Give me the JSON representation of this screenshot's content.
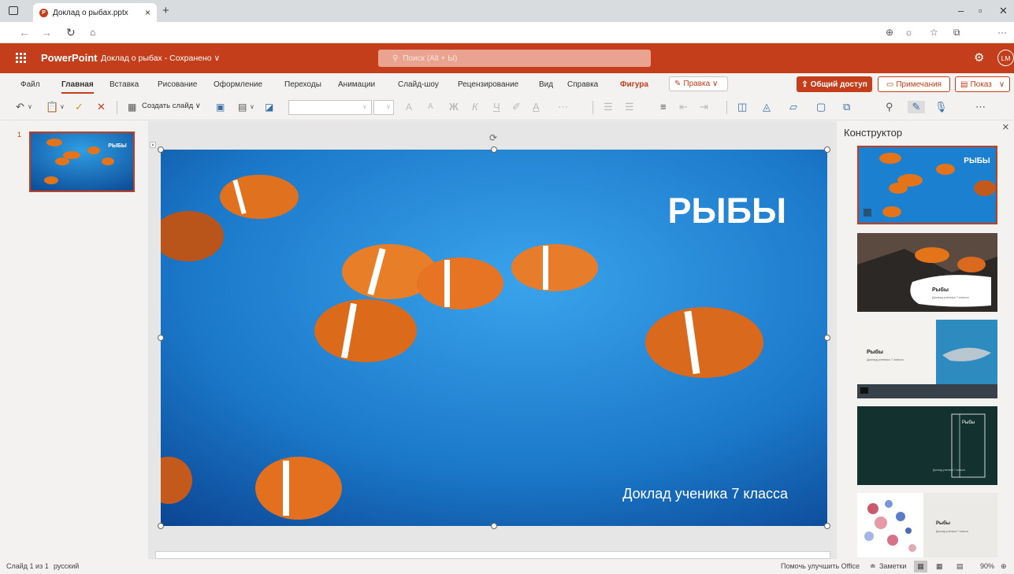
{
  "browser": {
    "tab_title": "Доклад о рыбах.pptx",
    "tab_close": "×",
    "new_tab": "+",
    "minimize": "–",
    "maximize": "▫",
    "close": "✕",
    "more": "···"
  },
  "header": {
    "app_name": "PowerPoint",
    "doc_title": "Доклад о рыбах - Сохранено ∨",
    "search_placeholder": "Поиск (Alt + Ы)",
    "avatar_initials": "LM"
  },
  "ribbon": {
    "tabs": [
      "Файл",
      "Главная",
      "Вставка",
      "Рисование",
      "Оформление",
      "Переходы",
      "Анимации",
      "Слайд-шоу",
      "Рецензирование",
      "Вид",
      "Справка",
      "Фигура"
    ],
    "edit_label": "Правка ∨",
    "share_label": "Общий доступ",
    "comments_label": "Примечания",
    "show_label": "Показ",
    "new_slide_label": "Создать слайд ∨",
    "bold": "Ж",
    "italic": "К",
    "underline": "Ч",
    "grow_font": "A",
    "shrink_font": "A"
  },
  "thumbnails": {
    "slide_number": "1",
    "thumb_title": "РЫБЫ"
  },
  "slide": {
    "title": "РЫБЫ",
    "subtitle": "Доклад ученика 7 класса"
  },
  "designer": {
    "title": "Конструктор",
    "close": "×",
    "designs": [
      {
        "title": "РЫБЫ"
      },
      {
        "title": "Рыбы",
        "subtitle": "Доклад ученика 7 класса"
      },
      {
        "title": "Рыбы",
        "subtitle": "Доклад ученика 7 класса"
      },
      {
        "title": "Рыбы",
        "subtitle": "Доклад ученика 7 класса"
      },
      {
        "title": "Рыбы",
        "subtitle": "Доклад ученика 7 класса"
      }
    ]
  },
  "status": {
    "slide_info": "Слайд 1 из 1",
    "language": "русский",
    "feedback": "Помочь улучшить Office",
    "notes": "Заметки",
    "zoom": "90%"
  }
}
